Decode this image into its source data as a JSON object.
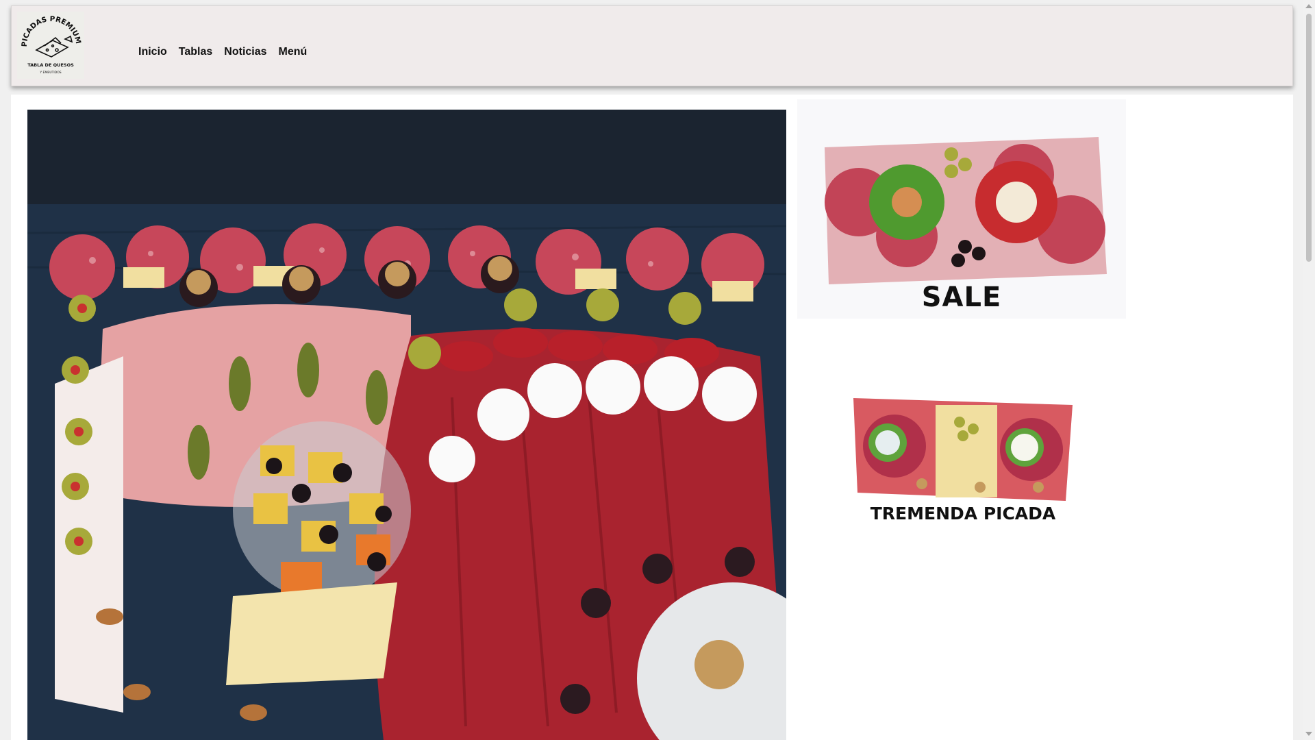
{
  "logo": {
    "arc_text": "PICADAS PREMIUM",
    "line1": "TABLA DE QUESOS",
    "line2": "Y EMBUTIDOS"
  },
  "nav": {
    "items": [
      {
        "label": "Inicio"
      },
      {
        "label": "Tablas"
      },
      {
        "label": "Noticias"
      },
      {
        "label": "Menú"
      }
    ]
  },
  "promos": [
    {
      "label": "SALE"
    },
    {
      "label": "TREMENDA PICADA"
    }
  ],
  "colors": {
    "header_bg": "#f0ebeb",
    "page_bg": "#ffffff",
    "hero_bg": "#1b2430"
  }
}
